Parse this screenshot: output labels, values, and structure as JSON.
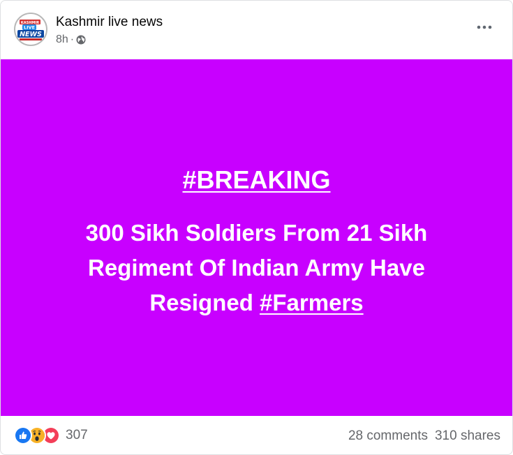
{
  "post": {
    "page_name": "Kashmir live news",
    "time": "8h",
    "separator": "·",
    "privacy_icon": "globe-icon",
    "more_icon": "more-options-icon",
    "avatar_logo": {
      "top_text": "KASHMIR",
      "mid_text": "LIVE",
      "bottom_text": "NEWS"
    }
  },
  "image": {
    "background": "#c800ff",
    "headline": "#BREAKING",
    "body_main": "300 Sikh Soldiers From 21 Sikh Regiment Of Indian Army Have Resigned ",
    "body_hashtag": "#Farmers"
  },
  "footer": {
    "reaction_icons": [
      "like-icon",
      "wow-icon",
      "love-icon"
    ],
    "reaction_count": "307",
    "comments": "28 comments",
    "shares": "310 shares"
  },
  "colors": {
    "like": "#1877f2",
    "wow": "#f7b125",
    "love": "#f33e58",
    "meta_text": "#65676b"
  }
}
